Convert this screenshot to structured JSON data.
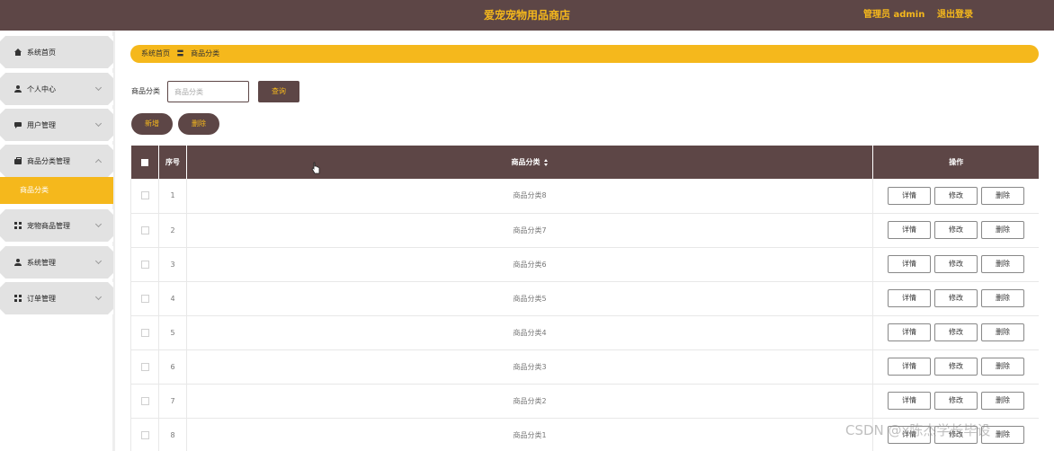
{
  "header": {
    "title": "爱宠宠物用品商店",
    "admin_label": "管理员 admin",
    "logout_label": "退出登录"
  },
  "sidebar": {
    "items": [
      {
        "label": "系统首页",
        "icon": "home-icon"
      },
      {
        "label": "个人中心",
        "icon": "user-icon"
      },
      {
        "label": "用户管理",
        "icon": "chat-icon"
      },
      {
        "label": "商品分类管理",
        "icon": "briefcase-icon"
      },
      {
        "label": "宠物商品管理",
        "icon": "grid-icon"
      },
      {
        "label": "系统管理",
        "icon": "user-icon"
      },
      {
        "label": "订单管理",
        "icon": "grid-icon"
      }
    ],
    "active_sub": "商品分类"
  },
  "breadcrumb": {
    "home": "系统首页",
    "separator": "〓",
    "current": "商品分类"
  },
  "search": {
    "label": "商品分类",
    "placeholder": "商品分类",
    "value": "",
    "button": "查询"
  },
  "actions": {
    "add": "新增",
    "delete": "删除"
  },
  "table": {
    "headers": {
      "index": "序号",
      "category": "商品分类",
      "ops": "操作"
    },
    "row_actions": {
      "detail": "详情",
      "edit": "修改",
      "delete": "删除"
    },
    "rows": [
      {
        "index": "1",
        "category": "商品分类8"
      },
      {
        "index": "2",
        "category": "商品分类7"
      },
      {
        "index": "3",
        "category": "商品分类6"
      },
      {
        "index": "4",
        "category": "商品分类5"
      },
      {
        "index": "5",
        "category": "商品分类4"
      },
      {
        "index": "6",
        "category": "商品分类3"
      },
      {
        "index": "7",
        "category": "商品分类2"
      },
      {
        "index": "8",
        "category": "商品分类1"
      }
    ]
  },
  "watermark": "CSDN @x陈杰学长毕设",
  "colors": {
    "brand_dark": "#5d4646",
    "accent": "#f5b81c"
  }
}
